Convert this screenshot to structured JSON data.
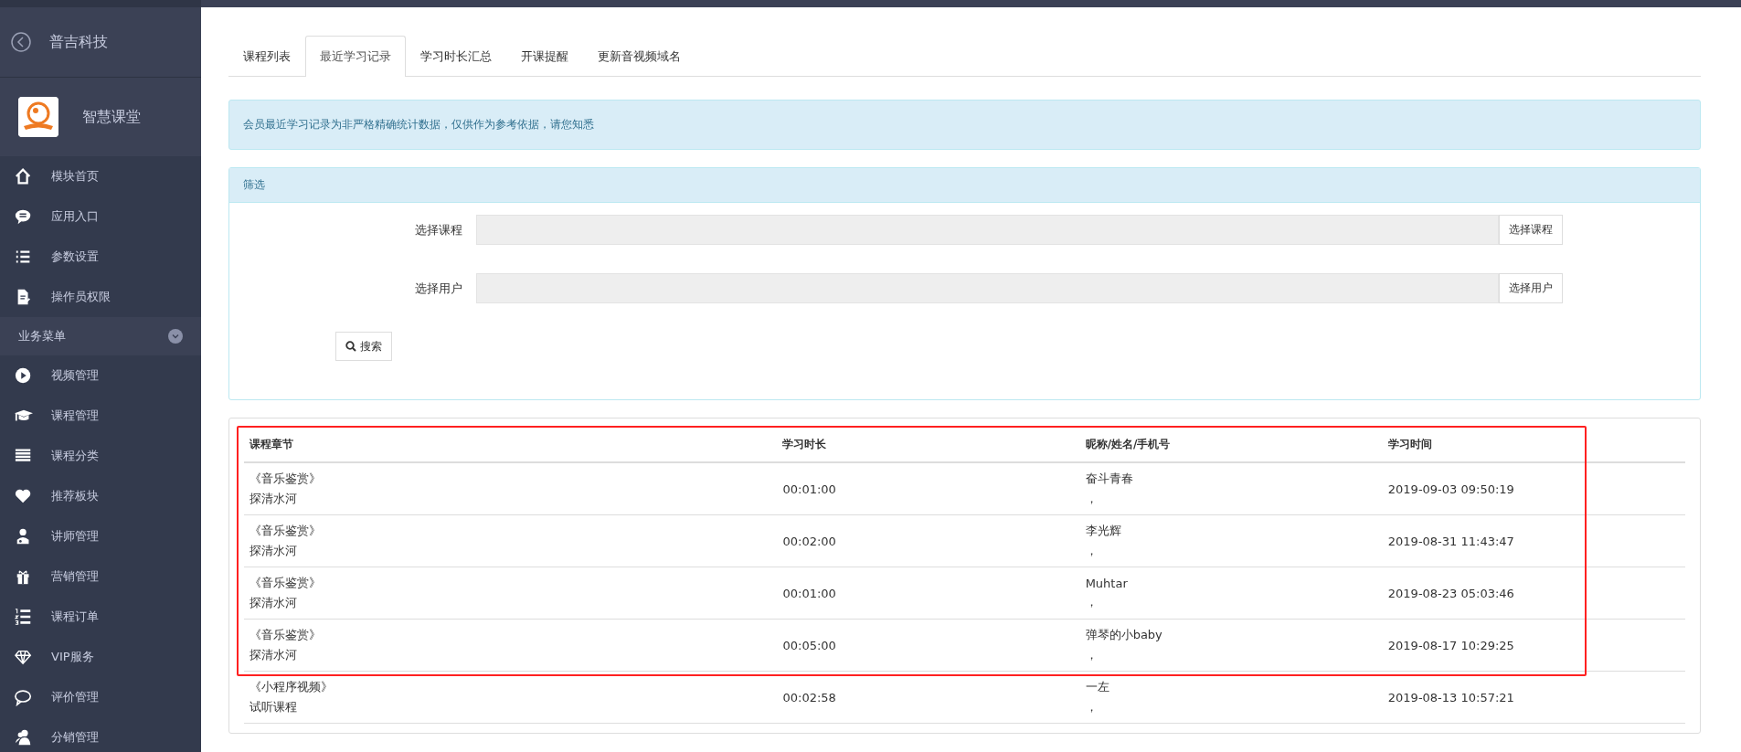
{
  "sidebar": {
    "company": "普吉科技",
    "app_name": "智慧课堂",
    "top_items": [
      {
        "label": "模块首页"
      },
      {
        "label": "应用入口"
      },
      {
        "label": "参数设置"
      },
      {
        "label": "操作员权限"
      }
    ],
    "section": {
      "label": "业务菜单",
      "expanded": true
    },
    "items": [
      {
        "label": "视频管理"
      },
      {
        "label": "课程管理"
      },
      {
        "label": "课程分类"
      },
      {
        "label": "推荐板块"
      },
      {
        "label": "讲师管理"
      },
      {
        "label": "营销管理"
      },
      {
        "label": "课程订单"
      },
      {
        "label": "VIP服务"
      },
      {
        "label": "评价管理"
      },
      {
        "label": "分销管理"
      }
    ]
  },
  "tabs": [
    {
      "label": "课程列表",
      "selected": false
    },
    {
      "label": "最近学习记录",
      "selected": true
    },
    {
      "label": "学习时长汇总",
      "selected": false
    },
    {
      "label": "开课提醒",
      "selected": false
    },
    {
      "label": "更新音视频域名",
      "selected": false
    }
  ],
  "notice": "会员最近学习记录为非严格精确统计数据，仅供作为参考依据，请您知悉",
  "filter": {
    "title": "筛选",
    "fields": [
      {
        "label": "选择课程",
        "button": "选择课程"
      },
      {
        "label": "选择用户",
        "button": "选择用户"
      }
    ],
    "search_button": "搜索"
  },
  "table": {
    "columns": [
      "课程章节",
      "学习时长",
      "昵称/姓名/手机号",
      "学习时间"
    ],
    "rows": [
      {
        "course": "《音乐鉴赏》",
        "chapter": "探清水河",
        "duration": "00:01:00",
        "name": "奋斗青春",
        "contact": "，",
        "time": "2019-09-03 09:50:19"
      },
      {
        "course": "《音乐鉴赏》",
        "chapter": "探清水河",
        "duration": "00:02:00",
        "name": "李光辉",
        "contact": "，",
        "time": "2019-08-31 11:43:47"
      },
      {
        "course": "《音乐鉴赏》",
        "chapter": "探清水河",
        "duration": "00:01:00",
        "name": "Muhtar",
        "contact": "，",
        "time": "2019-08-23 05:03:46"
      },
      {
        "course": "《音乐鉴赏》",
        "chapter": "探清水河",
        "duration": "00:05:00",
        "name": "弹琴的小baby",
        "contact": "，",
        "time": "2019-08-17 10:29:25"
      },
      {
        "course": "《小程序视频》",
        "chapter": "试听课程",
        "duration": "00:02:58",
        "name": "一左",
        "contact": "，",
        "time": "2019-08-13 10:57:21"
      }
    ]
  },
  "highlight": {
    "shown": true
  }
}
